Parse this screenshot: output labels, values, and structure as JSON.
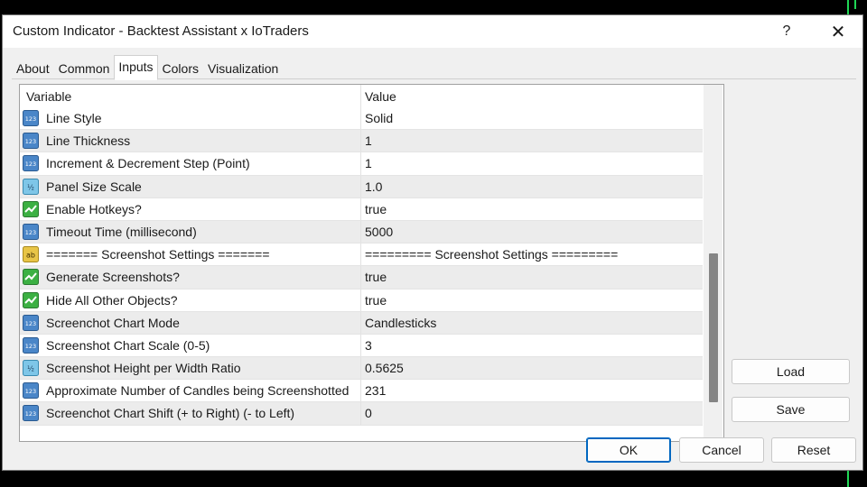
{
  "window": {
    "title": "Custom Indicator - Backtest Assistant x IoTraders",
    "help_label": "?",
    "close_label": "✕"
  },
  "tabs": [
    {
      "label": "About",
      "active": false
    },
    {
      "label": "Common",
      "active": false
    },
    {
      "label": "Inputs",
      "active": true
    },
    {
      "label": "Colors",
      "active": false
    },
    {
      "label": "Visualization",
      "active": false
    }
  ],
  "grid": {
    "columns": [
      "Variable",
      "Value"
    ],
    "rows": [
      {
        "icon": "integer-icon",
        "name": "Line Style",
        "value": "Solid"
      },
      {
        "icon": "integer-icon",
        "name": "Line Thickness",
        "value": "1"
      },
      {
        "icon": "integer-icon",
        "name": "Increment & Decrement Step (Point)",
        "value": "1"
      },
      {
        "icon": "double-icon",
        "name": "Panel Size Scale",
        "value": "1.0"
      },
      {
        "icon": "bool-icon",
        "name": "Enable Hotkeys?",
        "value": "true"
      },
      {
        "icon": "integer-icon",
        "name": "Timeout Time (millisecond)",
        "value": "5000"
      },
      {
        "icon": "string-icon",
        "name": "======= Screenshot Settings =======",
        "value": "========= Screenshot Settings ========="
      },
      {
        "icon": "bool-icon",
        "name": "Generate Screenshots?",
        "value": "true"
      },
      {
        "icon": "bool-icon",
        "name": "Hide All Other Objects?",
        "value": "true"
      },
      {
        "icon": "integer-icon",
        "name": "Screenchot Chart Mode",
        "value": "Candlesticks"
      },
      {
        "icon": "integer-icon",
        "name": "Screenshot Chart Scale (0-5)",
        "value": "3"
      },
      {
        "icon": "double-icon",
        "name": "Screenshot Height per Width Ratio",
        "value": "0.5625"
      },
      {
        "icon": "integer-icon",
        "name": "Approximate Number of Candles being Screenshotted",
        "value": "231"
      },
      {
        "icon": "integer-icon",
        "name": "Screenchot Chart Shift (+ to Right) (- to Left)",
        "value": "0"
      }
    ]
  },
  "side_buttons": {
    "load": "Load",
    "save": "Save"
  },
  "footer_buttons": {
    "ok": "OK",
    "cancel": "Cancel",
    "reset": "Reset"
  },
  "colors": {
    "primary_border": "#0067c0",
    "bool_icon": "#3cb043",
    "integer_icon": "#4a86c8",
    "double_icon": "#7ec6e8",
    "string_icon": "#e8c547"
  }
}
